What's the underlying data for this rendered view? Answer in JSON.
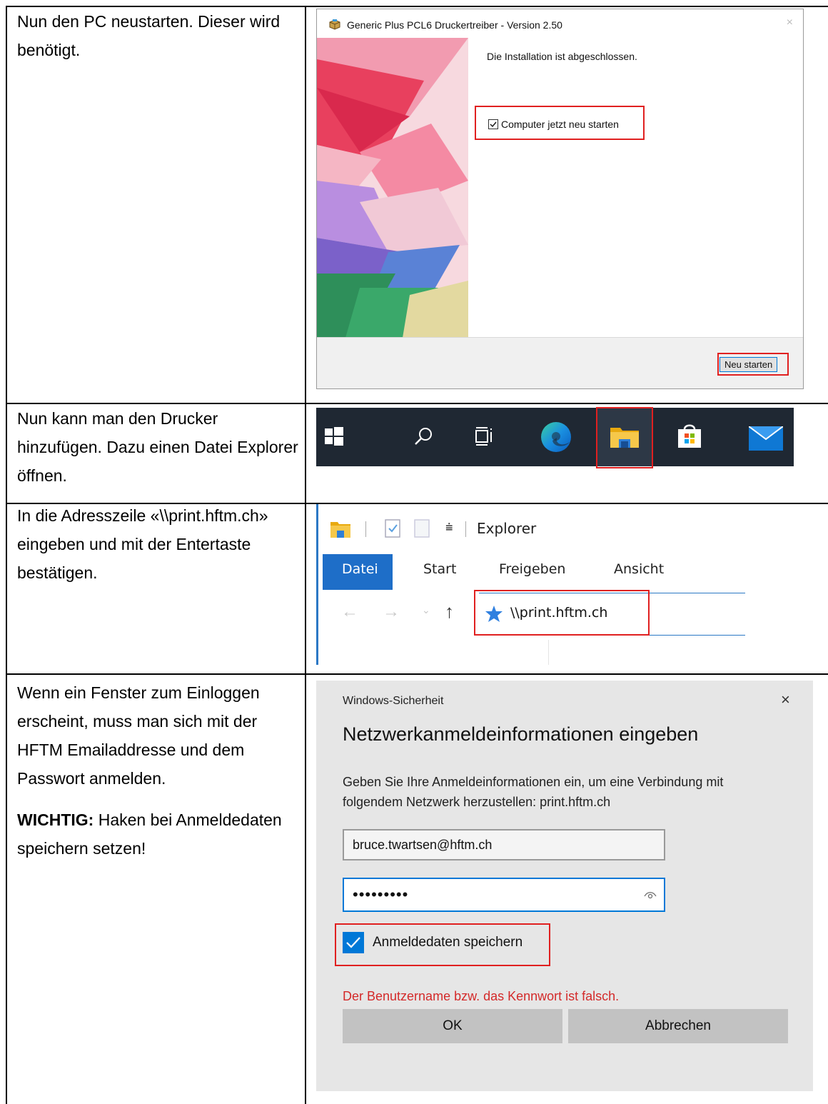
{
  "steps": [
    {
      "text": [
        "Nun den PC neustarten. Dieser wird benötigt."
      ]
    },
    {
      "text": [
        "Nun kann man den Drucker hinzufügen. Dazu einen Datei Explorer öffnen."
      ]
    },
    {
      "text": [
        "In die Adresszeile «\\\\print.hftm.ch» eingeben und mit der Entertaste bestätigen."
      ]
    },
    {
      "text": [
        "Wenn ein Fenster zum Einloggen erscheint, muss man sich mit der HFTM Emailaddresse und dem Passwort anmelden."
      ],
      "important_label": "WICHTIG:",
      "important_text": " Haken bei Anmeldedaten speichern setzen!"
    }
  ],
  "installer": {
    "title": "Generic Plus PCL6 Druckertreiber - Version 2.50",
    "message": "Die Installation ist abgeschlossen.",
    "checkbox_label": "Computer jetzt neu starten",
    "button": "Neu starten",
    "close": "×"
  },
  "explorer": {
    "window_title": "Explorer",
    "tabs": [
      "Datei",
      "Start",
      "Freigeben",
      "Ansicht"
    ],
    "address": "\\\\print.hftm.ch"
  },
  "security": {
    "title": "Windows-Sicherheit",
    "heading": "Netzwerkanmeldeinformationen eingeben",
    "description": "Geben Sie Ihre Anmeldeinformationen ein, um eine Verbindung mit folgendem Netzwerk herzustellen: print.hftm.ch",
    "username": "bruce.twartsen@hftm.ch",
    "password": "•••••••••",
    "remember_label": "Anmeldedaten speichern",
    "error": "Der Benutzername bzw. das Kennwort ist falsch.",
    "ok": "OK",
    "cancel": "Abbrechen",
    "close": "×"
  },
  "colors": {
    "highlight": "#e02020",
    "accent": "#0078d7",
    "error": "#d42a2a",
    "taskbar": "#1f2833"
  }
}
